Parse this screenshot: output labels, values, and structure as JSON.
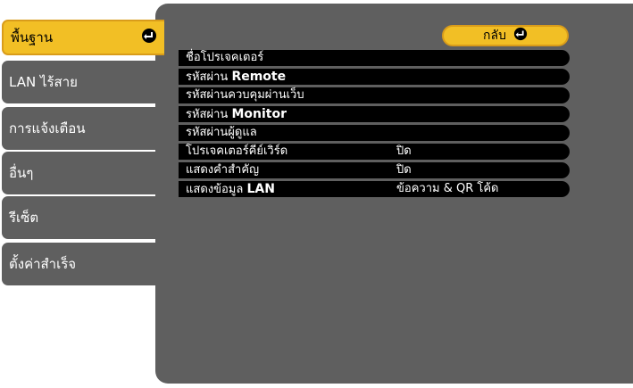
{
  "sidebar": {
    "items": [
      {
        "label": "พื้นฐาน",
        "active": true
      },
      {
        "label": "LAN ไร้สาย"
      },
      {
        "label": "การแจ้งเตือน"
      },
      {
        "label": "อื่นๆ"
      },
      {
        "label": "รีเซ็ต"
      },
      {
        "label": "ตั้งค่าสำเร็จ"
      }
    ]
  },
  "back_button": {
    "label": "กลับ",
    "icon": "enter-icon"
  },
  "menu": {
    "items": [
      {
        "label": "ชื่อโปรเจคเตอร์",
        "value": ""
      },
      {
        "label": "รหัสผ่าน",
        "suffix": "Remote",
        "value": ""
      },
      {
        "label": "รหัสผ่านควบคุมผ่านเว็บ",
        "value": ""
      },
      {
        "label": "รหัสผ่าน",
        "suffix": "Monitor",
        "value": ""
      },
      {
        "label": "รหัสผ่านผู้ดูแล",
        "value": ""
      },
      {
        "label": "โปรเจคเตอร์คีย์เวิร์ด",
        "value": "ปิด"
      },
      {
        "label": "แสดงคำสำคัญ",
        "value": "ปิด"
      },
      {
        "label": "แสดงข้อมูล",
        "suffix": "LAN",
        "value": "ข้อความ & QR โค้ด"
      }
    ]
  },
  "colors": {
    "panel": "#5f5f5f",
    "accent": "#f2bf25",
    "row": "#000000"
  }
}
